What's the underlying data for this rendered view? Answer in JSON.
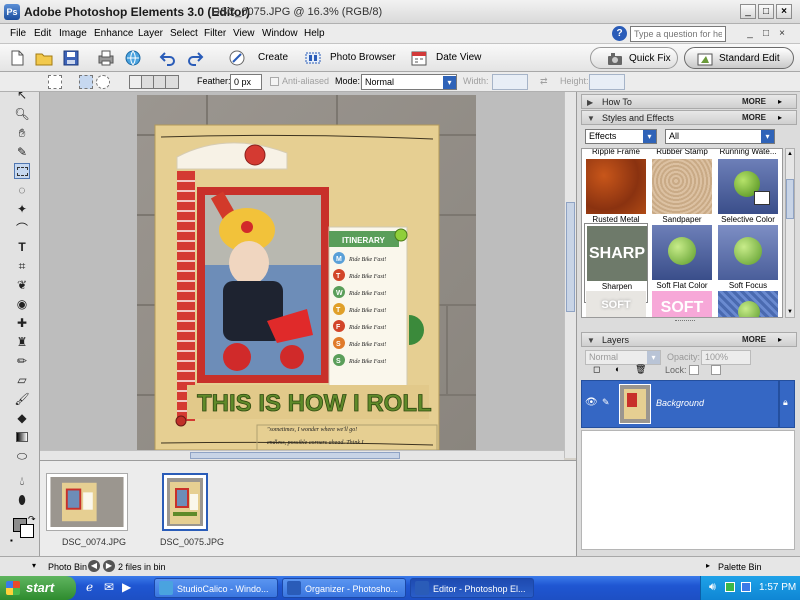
{
  "window": {
    "app_title": "Adobe Photoshop Elements 3.0 (Editor)",
    "doc_title": "DSC_0075.JPG @ 16.3% (RGB/8)",
    "controls": [
      "_",
      "□",
      "×"
    ]
  },
  "menu": {
    "items": [
      "File",
      "Edit",
      "Image",
      "Enhance",
      "Layer",
      "Select",
      "Filter",
      "View",
      "Window",
      "Help"
    ],
    "help_placeholder": "Type a question for help",
    "mdi_controls": [
      "_",
      "□",
      "×"
    ]
  },
  "shortcuts": {
    "create": "Create",
    "photo_browser": "Photo Browser",
    "date_view": "Date View",
    "quick_fix": "Quick Fix",
    "standard_edit": "Standard Edit"
  },
  "options": {
    "feather_label": "Feather:",
    "feather_value": "0 px",
    "anti_aliased": "Anti-aliased",
    "mode_label": "Mode:",
    "mode_value": "Normal",
    "width_label": "Width:",
    "height_label": "Height:"
  },
  "canvas": {
    "itinerary": "ITINERARY",
    "headline": "THIS IS HOW I ROLL",
    "caption_line1": "\"sometimes, I wonder where we'll go!",
    "caption_line2": "endless, possible corners ahead. Think I",
    "letters": [
      "M",
      "T",
      "W",
      "T",
      "F",
      "S",
      "S"
    ],
    "entries": [
      "Ride Bike Fast!",
      "Ride Bike Fast!",
      "Ride Bike Fast!",
      "Ride Bike Fast!",
      "Ride Bike Fast!",
      "Ride Bike Fast!",
      "Ride Bike Fast!"
    ]
  },
  "photo_bin": {
    "thumbs": [
      {
        "label": "DSC_0074.JPG"
      },
      {
        "label": "DSC_0075.JPG"
      }
    ]
  },
  "status": {
    "photo_bin": "Photo Bin",
    "files": "2 files in bin",
    "palette_bin": "Palette Bin"
  },
  "palettes": {
    "how_to": "How To",
    "styles_effects": "Styles and Effects",
    "more": "MORE",
    "category": "Effects",
    "filter": "All",
    "effects": [
      "Ripple Frame",
      "Rubber Stamp",
      "Running Wate...",
      "Rusted Metal",
      "Sandpaper",
      "Selective Color",
      "Sharpen",
      "Soft Flat Color",
      "Soft Focus",
      "SOFT GLOW",
      "SOFT",
      ""
    ],
    "sharp_text": "SHARP",
    "layers": "Layers",
    "blend_mode": "Normal",
    "opacity_label": "Opacity:",
    "opacity_value": "100%",
    "lock_label": "Lock:",
    "layer_name": "Background"
  },
  "taskbar": {
    "start": "start",
    "tasks": [
      "StudioCalico - Windo...",
      "Organizer - Photosho...",
      "Editor - Photoshop El..."
    ],
    "clock": "1:57 PM"
  }
}
